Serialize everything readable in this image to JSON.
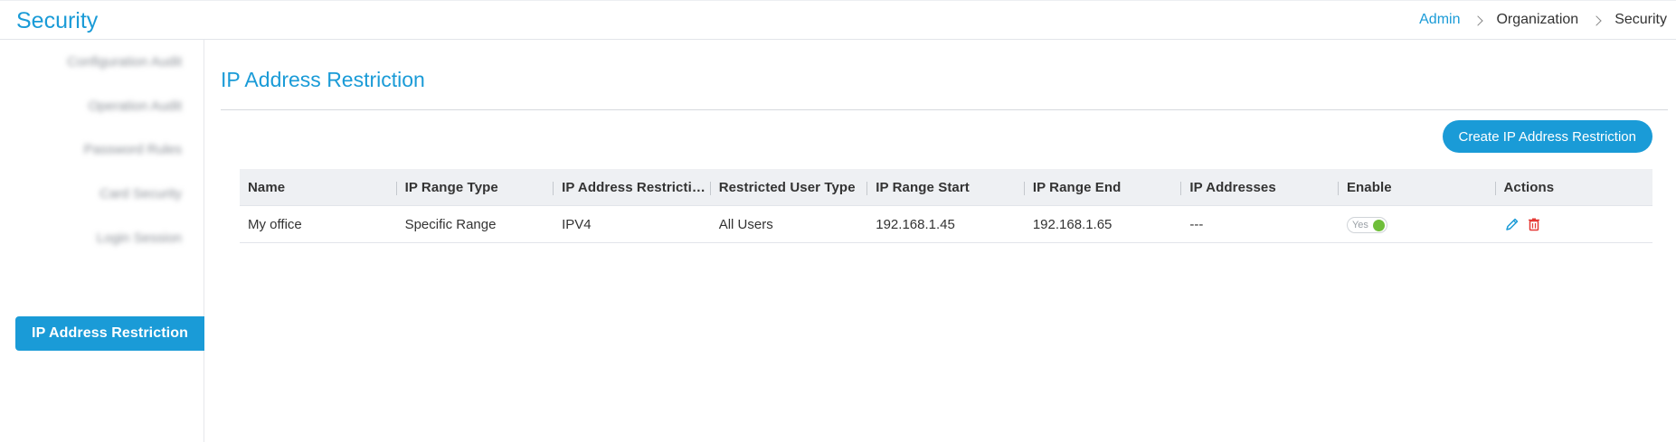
{
  "header": {
    "title": "Security",
    "breadcrumbs": [
      "Admin",
      "Organization",
      "Security"
    ]
  },
  "sidebar": {
    "items": [
      {
        "label": "Configuration Audit",
        "blurred": true
      },
      {
        "label": "Operation Audit",
        "blurred": true
      },
      {
        "label": "Password Rules",
        "blurred": true
      },
      {
        "label": "Card Security",
        "blurred": true
      },
      {
        "label": "Login Session",
        "blurred": true
      },
      {
        "label": "IP Address Restriction",
        "active": true
      }
    ]
  },
  "main": {
    "title": "IP Address Restriction",
    "create_button": "Create IP Address Restriction",
    "table": {
      "columns": [
        "Name",
        "IP Range Type",
        "IP Address Restrictio...",
        "Restricted User Type",
        "IP Range Start",
        "IP Range End",
        "IP Addresses",
        "Enable",
        "Actions"
      ],
      "rows": [
        {
          "name": "My office",
          "range_type": "Specific Range",
          "ip_version": "IPV4",
          "user_type": "All Users",
          "range_start": "192.168.1.45",
          "range_end": "192.168.1.65",
          "ip_addresses": "---",
          "enable_label": "Yes",
          "enabled": true
        }
      ]
    }
  },
  "colors": {
    "accent": "#1a9bd7",
    "toggle_on": "#6fbe3a",
    "delete": "#e53935"
  },
  "icons": {
    "edit": "pencil-icon",
    "delete": "trash-icon",
    "breadcrumb_separator": "chevron-right-icon"
  }
}
